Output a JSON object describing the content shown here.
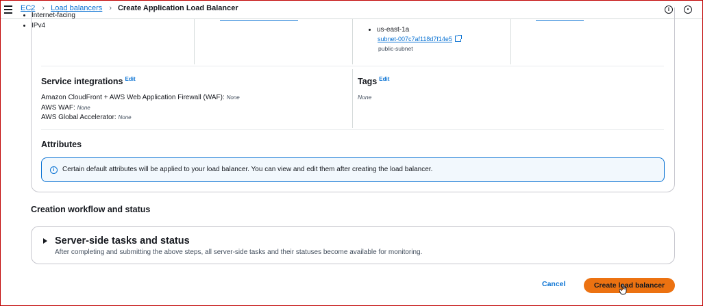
{
  "breadcrumb": {
    "items": [
      "EC2",
      "Load balancers"
    ],
    "current": "Create Application Load Balancer"
  },
  "network": {
    "scheme_items": [
      "Internet-facing",
      "IPv4"
    ],
    "region": "us-east-1a",
    "subnet_id": "subnet-007c7af118d7f14e5",
    "subnet_name": "public-subnet"
  },
  "service_integrations": {
    "title": "Service integrations",
    "edit": "Edit",
    "rows": [
      {
        "label": "Amazon CloudFront + AWS Web Application Firewall (WAF):",
        "value": "None"
      },
      {
        "label": "AWS WAF:",
        "value": "None"
      },
      {
        "label": "AWS Global Accelerator:",
        "value": "None"
      }
    ]
  },
  "tags": {
    "title": "Tags",
    "edit": "Edit",
    "value": "None"
  },
  "attributes": {
    "title": "Attributes",
    "info": "Certain default attributes will be applied to your load balancer. You can view and edit them after creating the load balancer."
  },
  "workflow": {
    "title": "Creation workflow and status",
    "tasks_title": "Server-side tasks and status",
    "tasks_desc": "After completing and submitting the above steps, all server-side tasks and their statuses become available for monitoring."
  },
  "actions": {
    "cancel": "Cancel",
    "create": "Create load balancer"
  },
  "icons": {
    "top_right": [
      "info-icon",
      "feedback-icon"
    ]
  },
  "colors": {
    "accent": "#0972d3",
    "primary_button": "#ec7211",
    "alert_bg": "#f2f8fd"
  }
}
